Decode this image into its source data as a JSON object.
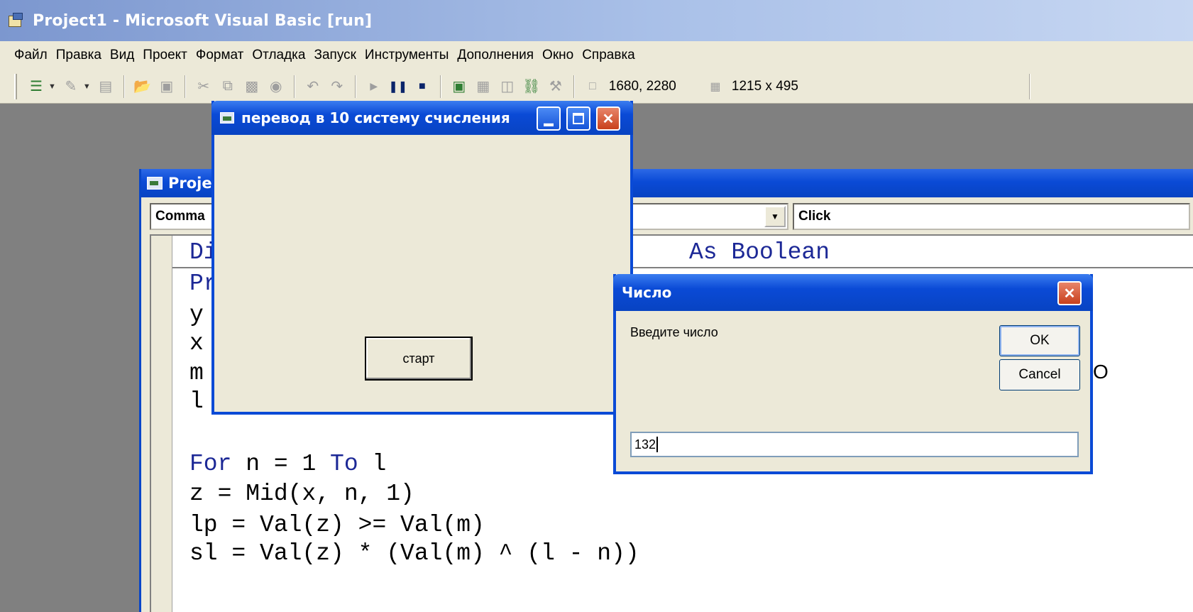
{
  "window": {
    "title": "Project1 - Microsoft Visual Basic [run]"
  },
  "menu": [
    "Файл",
    "Правка",
    "Вид",
    "Проект",
    "Формат",
    "Отладка",
    "Запуск",
    "Инструменты",
    "Дополнения",
    "Окно",
    "Справка"
  ],
  "toolbar": {
    "position_readout": "1680, 2280",
    "size_readout": "1215 x 495",
    "icons": [
      "add-project-icon",
      "add-form-icon",
      "menu-editor-icon",
      "open-icon",
      "save-icon",
      "cut-icon",
      "copy-icon",
      "paste-icon",
      "find-icon",
      "undo-icon",
      "redo-icon",
      "run-icon",
      "pause-icon",
      "stop-icon",
      "project-explorer-icon",
      "properties-icon",
      "form-layout-icon",
      "object-browser-icon",
      "toolbox-icon",
      "position-icon",
      "size-icon"
    ]
  },
  "code_window": {
    "title": "Proje",
    "object_combo": "Comma",
    "procedure_combo": "Click",
    "lines": [
      {
        "text": "Di",
        "tail": "As Boolean"
      },
      {
        "text": "Pr"
      },
      {
        "text": "y"
      },
      {
        "text": "x"
      },
      {
        "text": "m"
      },
      {
        "text": "l"
      },
      {
        "text": "For n = 1 To l"
      },
      {
        "text": "z = Mid(x, n, 1)"
      },
      {
        "text": "lp = Val(z) >= Val(m)"
      },
      {
        "text": "sl = Val(z) * (Val(m) ^ (l - n))"
      }
    ]
  },
  "form": {
    "title": "перевод в 10 систему счисления",
    "button_label": "старт"
  },
  "dialog": {
    "title": "Число",
    "prompt": "Введите число",
    "ok_label": "OK",
    "cancel_label": "Cancel",
    "input_value": "132"
  },
  "colors": {
    "title_blue": "#0a4ad6",
    "keyword_blue": "#1c2896",
    "close_red": "#c8401c",
    "face": "#ece9d8"
  }
}
